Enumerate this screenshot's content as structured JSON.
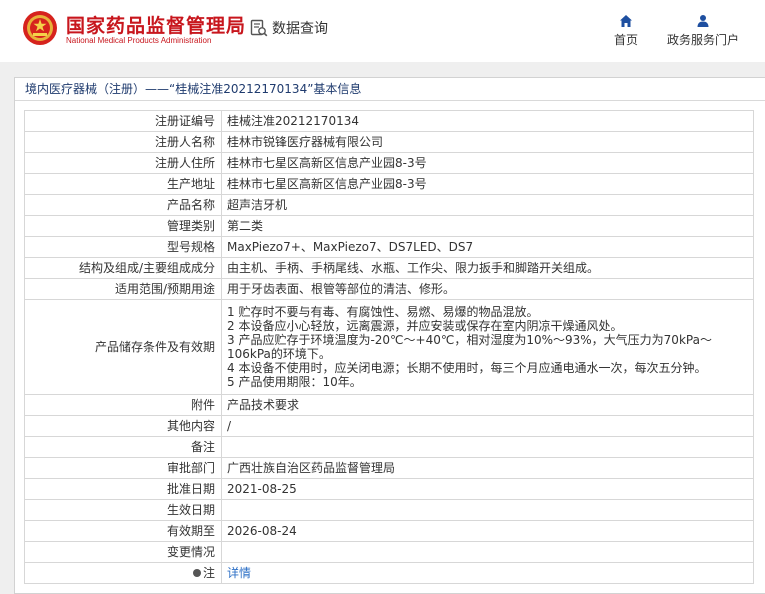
{
  "header": {
    "brand_cn": "国家药品监督管理局",
    "brand_en": "National Medical Products Administration",
    "search_label": "数据查询",
    "nav": [
      {
        "label": "首页",
        "icon": "home-icon"
      },
      {
        "label": "政务服务门户",
        "icon": "user-icon"
      }
    ],
    "brand_color": "#c8161d"
  },
  "panel": {
    "title": "境内医疗器械（注册）——“桂械注准20212170134”基本信息"
  },
  "rows": [
    {
      "label": "注册证编号",
      "value": "桂械注准20212170134"
    },
    {
      "label": "注册人名称",
      "value": "桂林市锐锋医疗器械有限公司"
    },
    {
      "label": "注册人住所",
      "value": "桂林市七星区高新区信息产业园8-3号"
    },
    {
      "label": "生产地址",
      "value": "桂林市七星区高新区信息产业园8-3号"
    },
    {
      "label": "产品名称",
      "value": "超声洁牙机"
    },
    {
      "label": "管理类别",
      "value": "第二类"
    },
    {
      "label": "型号规格",
      "value": "MaxPiezo7+、MaxPiezo7、DS7LED、DS7"
    },
    {
      "label": "结构及组成/主要组成成分",
      "value": "由主机、手柄、手柄尾线、水瓶、工作尖、限力扳手和脚踏开关组成。"
    },
    {
      "label": "适用范围/预期用途",
      "value": "用于牙齿表面、根管等部位的清洁、修形。"
    }
  ],
  "storage": {
    "label": "产品储存条件及有效期",
    "lines": [
      "1 贮存时不要与有毒、有腐蚀性、易燃、易爆的物品混放。",
      "2 本设备应小心轻放，远离震源，并应安装或保存在室内阴凉干燥通风处。",
      "3 产品应贮存于环境温度为-20℃～+40℃，相对湿度为10%～93%，大气压力为70kPa～106kPa的环境下。",
      "4 本设备不使用时，应关闭电源；长期不使用时，每三个月应通电通水一次，每次五分钟。",
      "5 产品使用期限：10年。"
    ]
  },
  "rows2": [
    {
      "label": "附件",
      "value": "产品技术要求"
    },
    {
      "label": "其他内容",
      "value": "/"
    },
    {
      "label": "备注",
      "value": ""
    },
    {
      "label": "审批部门",
      "value": "广西壮族自治区药品监督管理局"
    },
    {
      "label": "批准日期",
      "value": "2021-08-25"
    },
    {
      "label": "生效日期",
      "value": ""
    },
    {
      "label": "有效期至",
      "value": "2026-08-24"
    },
    {
      "label": "变更情况",
      "value": ""
    }
  ],
  "note": {
    "label": "注",
    "link": "详情"
  }
}
